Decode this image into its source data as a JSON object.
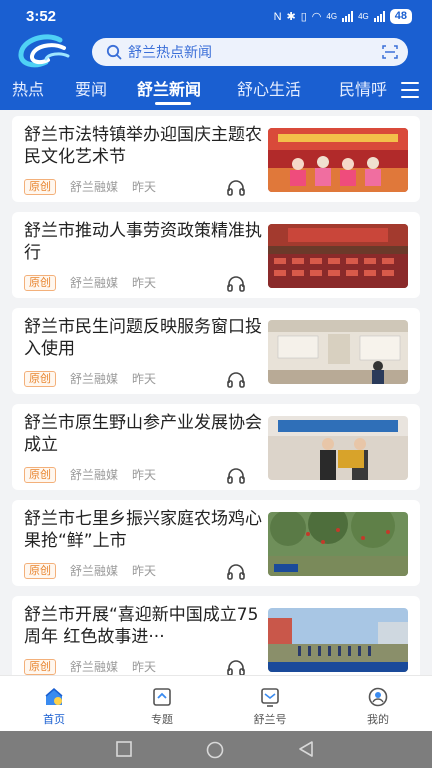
{
  "status_bar": {
    "time": "3:52",
    "battery": "48",
    "net_1": "4G",
    "net_2": "4G"
  },
  "search": {
    "placeholder": "舒兰热点新闻"
  },
  "tabs": [
    {
      "label": "热点"
    },
    {
      "label": "要闻"
    },
    {
      "label": "舒兰新闻",
      "active": true
    },
    {
      "label": "舒心生活"
    },
    {
      "label": "民情呼"
    }
  ],
  "articles": [
    {
      "title": "舒兰市法特镇举办迎国庆主题农民文化艺术节",
      "tag": "原创",
      "source": "舒兰融媒",
      "date": "昨天"
    },
    {
      "title": "舒兰市推动人事劳资政策精准执行",
      "tag": "原创",
      "source": "舒兰融媒",
      "date": "昨天"
    },
    {
      "title": "舒兰市民生问题反映服务窗口投入使用",
      "tag": "原创",
      "source": "舒兰融媒",
      "date": "昨天"
    },
    {
      "title": "舒兰市原生野山参产业发展协会成立",
      "tag": "原创",
      "source": "舒兰融媒",
      "date": "昨天"
    },
    {
      "title": "舒兰市七里乡振兴家庭农场鸡心果抢“鲜”上市",
      "tag": "原创",
      "source": "舒兰融媒",
      "date": "昨天"
    },
    {
      "title": "舒兰市开展“喜迎新中国成立75周年 红色故事进···",
      "tag": "原创",
      "source": "舒兰融媒",
      "date": "昨天"
    }
  ],
  "bottom_nav": [
    {
      "label": "首页",
      "active": true
    },
    {
      "label": "专题"
    },
    {
      "label": "舒兰号"
    },
    {
      "label": "我的"
    }
  ],
  "colors": {
    "brand": "#1a5fd1",
    "tag": "#e8852f",
    "background": "#f2f3f5"
  }
}
